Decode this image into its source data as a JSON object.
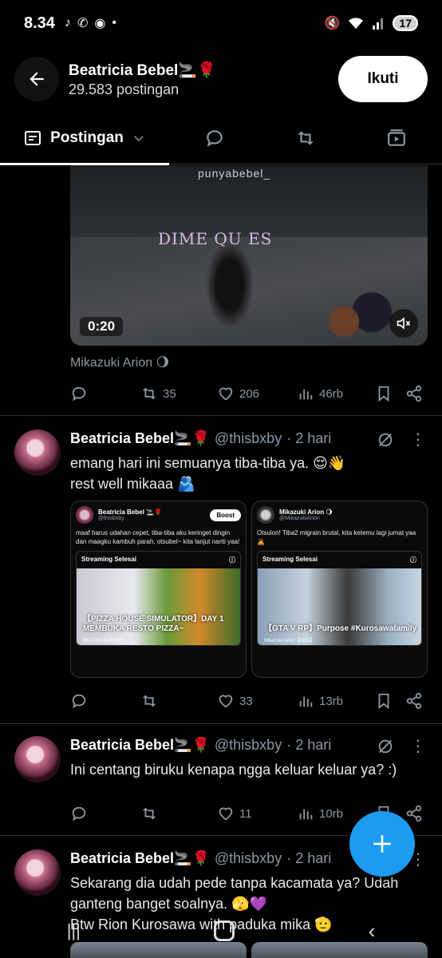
{
  "status_bar": {
    "time": "8.34",
    "battery": "17"
  },
  "header": {
    "name": "Beatricia Bebel🚬🌹",
    "post_count": "29.583 postingan",
    "follow_label": "Ikuti"
  },
  "tabs": {
    "active_label": "Postingan"
  },
  "video_tweet": {
    "watermark": "punyabebel_",
    "overlay_text": "DIME QU    ES",
    "duration": "0:20",
    "caption": "Mikazuki Arion 🌖",
    "replies": "",
    "retweets": "35",
    "likes": "206",
    "views": "46rb"
  },
  "tweets": [
    {
      "name": "Beatricia Bebel🚬🌹",
      "handle": "@thisbxby",
      "time": "· 2 hari",
      "text_line1": "emang hari ini semuanya tiba-tiba ya. 😌👋",
      "text_line2": "rest well mikaaa 🫂",
      "retweets": "",
      "likes": "33",
      "views": "13rb",
      "cards": [
        {
          "name": "Beatricia Bebel 🚬🌹",
          "handle": "@thisbxby",
          "boost": "Boost",
          "text": "maaf harus udahan cepet, tiba-tiba aku keringet dingin dan maagku kambuh parah, otsubel~ kita lanjut nanti yaa!",
          "stream_label": "Streaming Selesai",
          "stream_title": "【PIZZA HOUSE SIMULATOR】DAY 1 MEMBUKA RESTO PIZZA~",
          "stream_sub": "BEATRICIA BEBEL"
        },
        {
          "name": "Mikazuki Arion 🌖",
          "handle": "@MikazukiArion",
          "text": "Otsuion! Tiba2 migrain brutal, kita ketemu lagi jumat yaa🙇",
          "stream_label": "Streaming Selesai",
          "stream_title": "【GTA V RP】Purpose #Kurosawafamily",
          "stream_sub": "Mikazuki Arion【EOS】"
        }
      ]
    },
    {
      "name": "Beatricia Bebel🚬🌹",
      "handle": "@thisbxby",
      "time": "· 2 hari",
      "text_line1": "Ini centang biruku kenapa ngga keluar keluar ya? :)",
      "retweets": "",
      "likes": "11",
      "views": "10rb"
    },
    {
      "name": "Beatricia Bebel🚬🌹",
      "handle": "@thisbxby",
      "time": "· 2 hari",
      "text_line1": "Sekarang dia udah pede tanpa kacamata ya? Udah",
      "text_line2": "ganteng banget soalnya. 🫣💜",
      "text_line3": "Btw Rion Kurosawa with paduka mika 🫡"
    }
  ],
  "colors": {
    "accent": "#1d9bf0",
    "background": "#000000",
    "secondary_text": "#8b98a5"
  }
}
